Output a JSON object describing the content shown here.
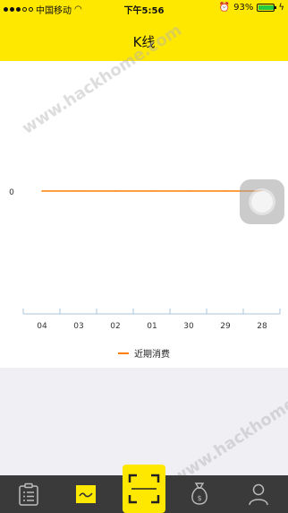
{
  "status_bar": {
    "carrier": "中国移动",
    "time": "下午5:56",
    "battery": "93%",
    "battery_level": 0.93
  },
  "header": {
    "title": "K线"
  },
  "watermark": "www.hackhome.com",
  "chart_data": {
    "type": "line",
    "categories": [
      "04",
      "03",
      "02",
      "01",
      "30",
      "29",
      "28"
    ],
    "series": [
      {
        "name": "近期消费",
        "values": [
          0,
          0,
          0,
          0,
          0,
          0,
          0
        ],
        "color": "#ff7f00"
      }
    ],
    "y_tick_labels": [
      "0"
    ],
    "legend_position": "bottom",
    "grid": false
  },
  "tabs": [
    {
      "id": "list",
      "icon": "clipboard-list-icon"
    },
    {
      "id": "kline",
      "icon": "kline-chart-icon",
      "active": true
    },
    {
      "id": "scan",
      "icon": "scan-frame-icon"
    },
    {
      "id": "money",
      "icon": "money-bag-icon"
    },
    {
      "id": "profile",
      "icon": "person-icon"
    }
  ],
  "colors": {
    "accent": "#ffe800",
    "series": "#ff7f00",
    "tabbar": "#3a3a3a"
  }
}
